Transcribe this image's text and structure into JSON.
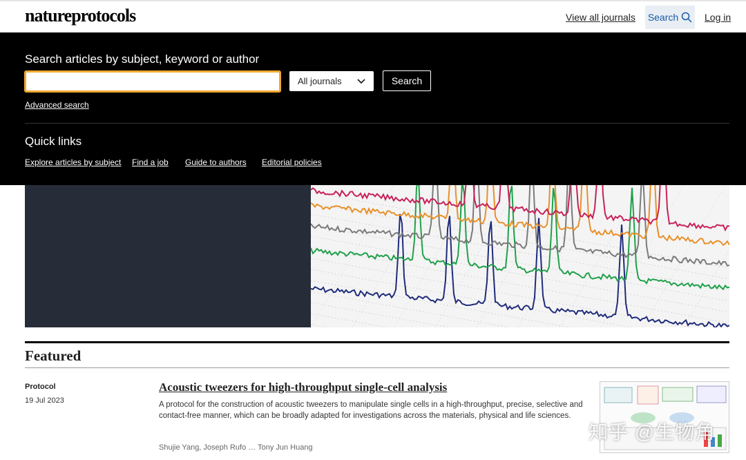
{
  "header": {
    "logo": "natureprotocols",
    "view_all_journals": "View all journals",
    "search_label": "Search",
    "login_label": "Log in"
  },
  "search_panel": {
    "heading": "Search articles by subject, keyword or author",
    "input_value": "",
    "journal_select_value": "All journals",
    "search_button": "Search",
    "advanced_search": "Advanced search",
    "quick_links_heading": "Quick links",
    "quick_links": [
      "Explore articles by subject",
      "Find a job",
      "Guide to authors",
      "Editorial policies"
    ]
  },
  "featured": {
    "heading": "Featured",
    "article": {
      "type": "Protocol",
      "date": "19 Jul 2023",
      "title": "Acoustic tweezers for high-throughput single-cell analysis",
      "abstract": "A protocol for the construction of acoustic tweezers to manipulate single cells in a high-throughput, precise, selective and contact-free manner, which can be broadly adapted for investigations across the materials, physical and life sciences.",
      "authors": "Shujie Yang, Joseph Rufo … Tony Jun Huang"
    }
  },
  "watermark": "知乎 @生物角",
  "colors": {
    "search_panel_bg": "#000000",
    "input_focus": "#f0a830",
    "hero_dark": "#272d38",
    "search_highlight": "#e8eef4",
    "series": [
      "#1f2b7a",
      "#1fa04a",
      "#7a7a7a",
      "#e8902a",
      "#c8205a"
    ]
  },
  "icons": {
    "search": "magnifier-icon",
    "select": "chevron-down-icon"
  }
}
